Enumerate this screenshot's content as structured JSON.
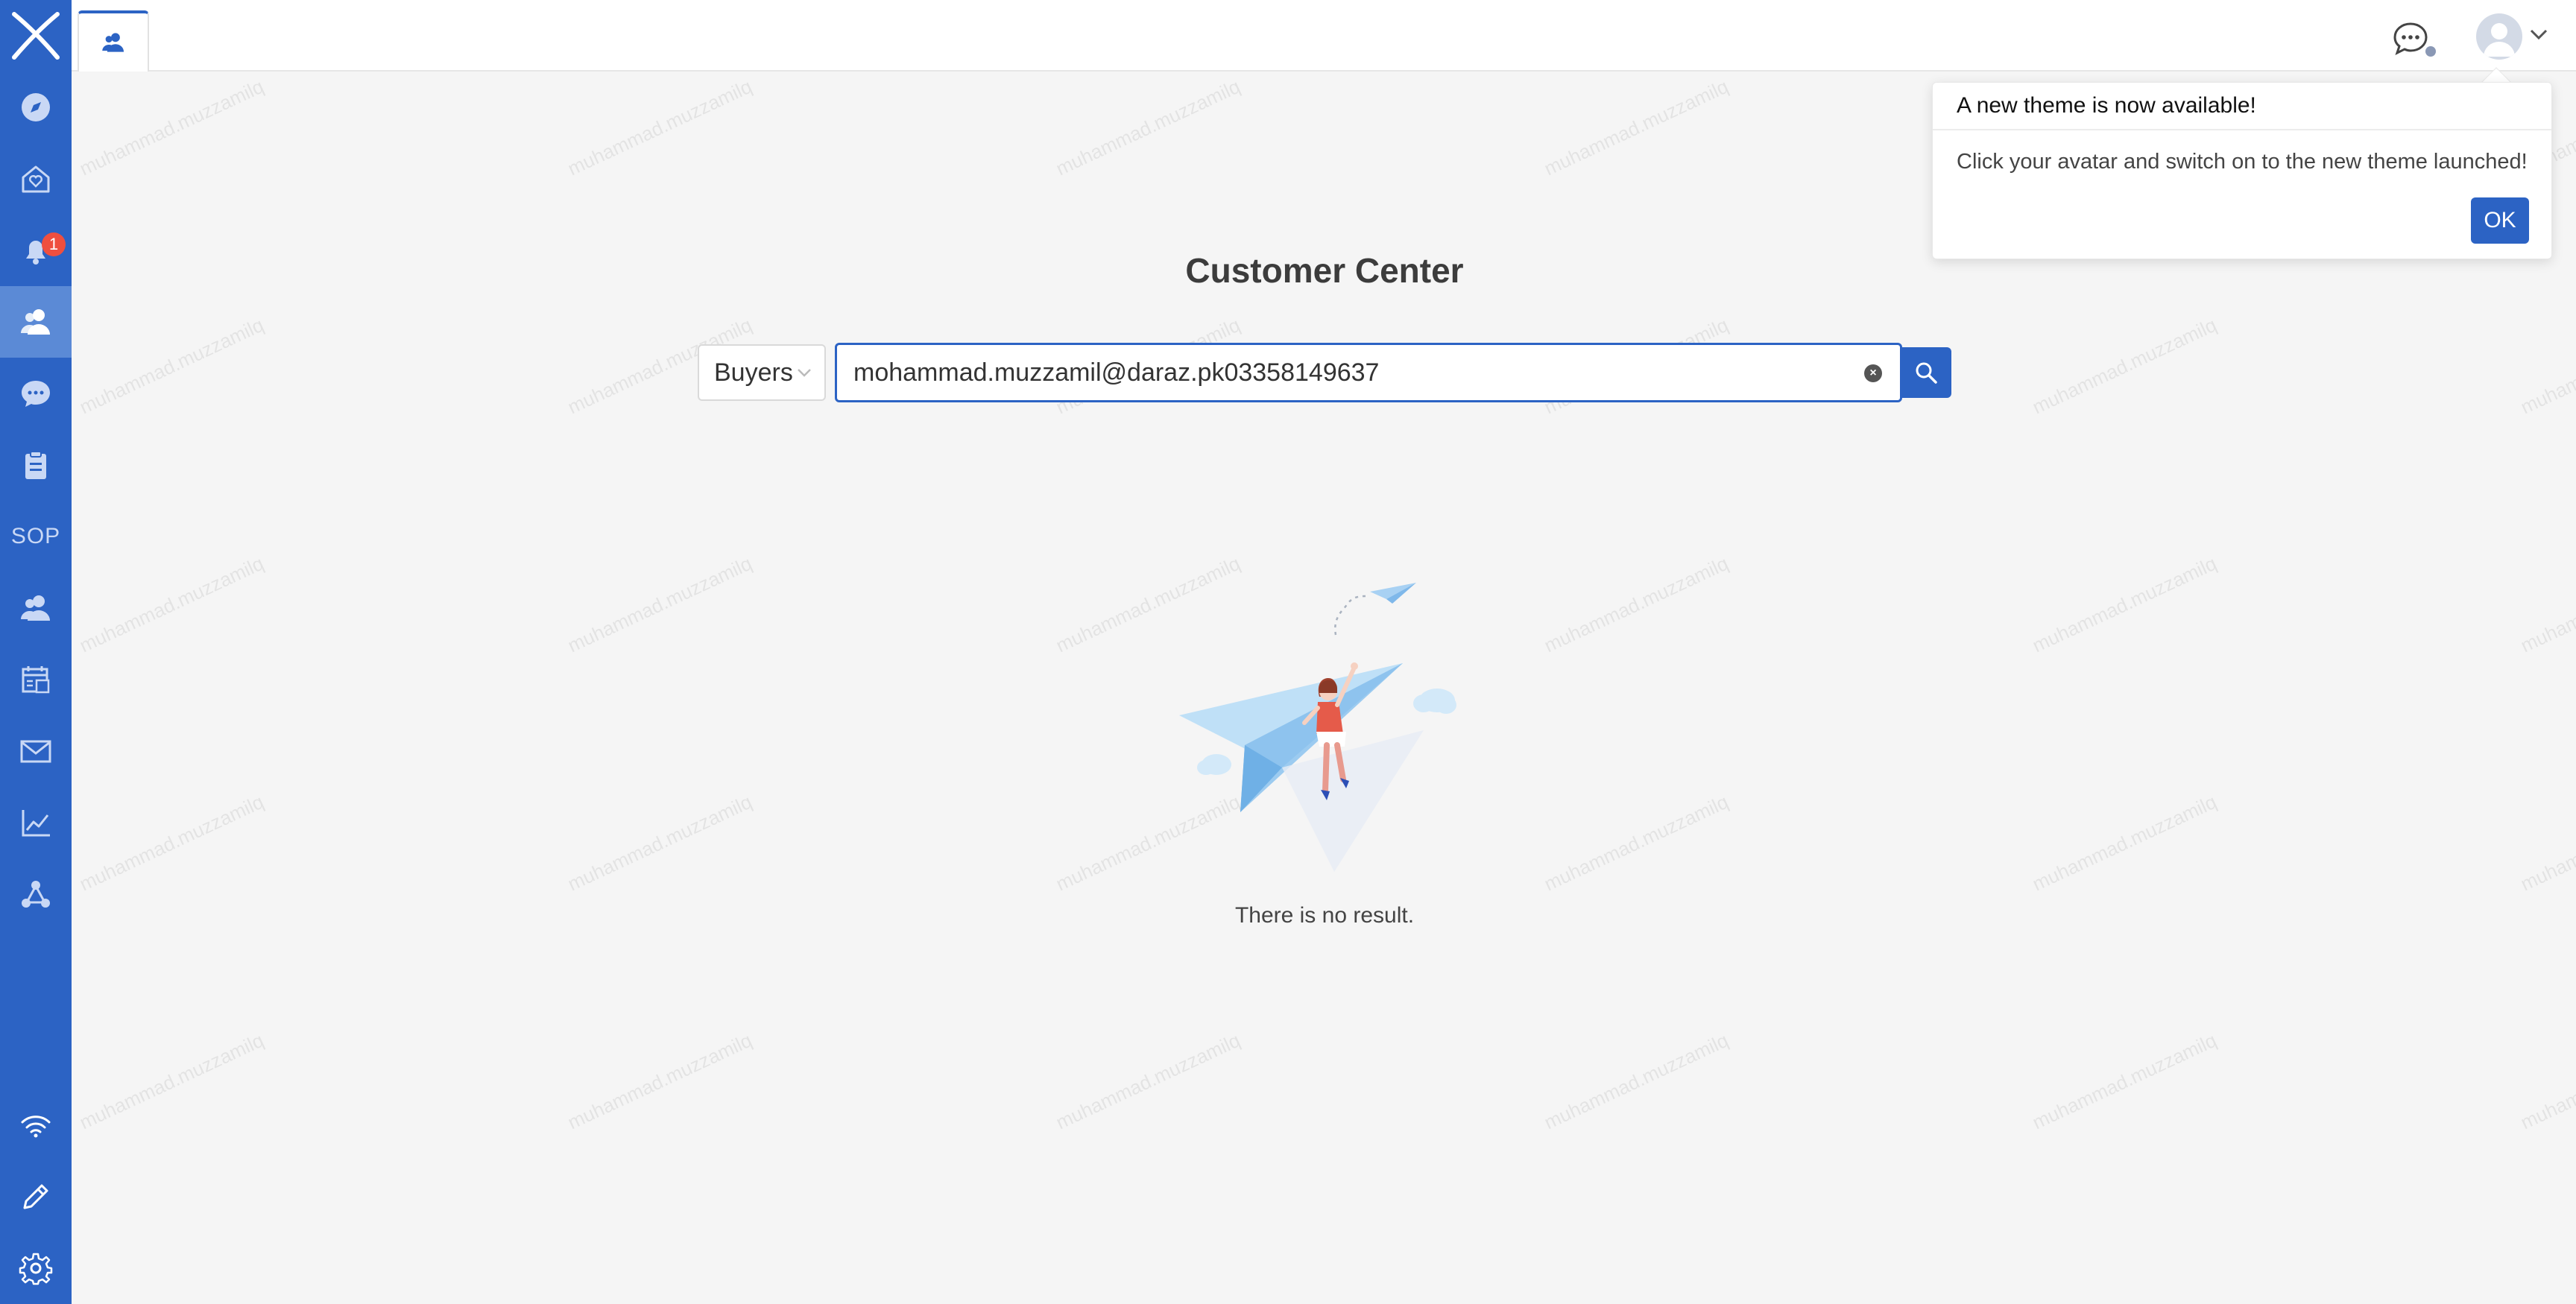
{
  "sidebar": {
    "logo_icon": "x-logo-icon",
    "items": [
      {
        "name": "compass",
        "icon": "compass-icon"
      },
      {
        "name": "home",
        "icon": "home-heart-icon"
      },
      {
        "name": "notifications",
        "icon": "bell-icon",
        "badge": "1"
      },
      {
        "name": "customers",
        "icon": "users-icon",
        "active": true
      },
      {
        "name": "chat",
        "icon": "chat-bubble-icon"
      },
      {
        "name": "tasks",
        "icon": "clipboard-icon"
      },
      {
        "name": "sop",
        "icon": "sop-icon",
        "label": "SOP"
      },
      {
        "name": "contacts",
        "icon": "users-icon"
      },
      {
        "name": "calendar",
        "icon": "calendar-icon"
      },
      {
        "name": "mail",
        "icon": "mail-icon"
      },
      {
        "name": "analytics",
        "icon": "line-chart-icon"
      },
      {
        "name": "network",
        "icon": "nodes-icon"
      }
    ],
    "bottom_items": [
      {
        "name": "wifi",
        "icon": "wifi-icon"
      },
      {
        "name": "edit",
        "icon": "pencil-icon"
      },
      {
        "name": "settings",
        "icon": "gear-icon"
      }
    ]
  },
  "topbar": {
    "active_tab_icon": "users-icon",
    "chat_icon": "chat-icon",
    "avatar_icon": "avatar-icon",
    "caret_icon": "chevron-down-icon"
  },
  "watermark": "muhammad.muzzamilq",
  "main": {
    "title": "Customer Center",
    "type_select": {
      "value": "Buyers"
    },
    "search": {
      "value": "mohammad.muzzamil@daraz.pk03358149637"
    },
    "empty_message": "There is no result."
  },
  "popover": {
    "title": "A new theme is now available!",
    "body": "Click your avatar and switch on to the new theme launched!",
    "ok_label": "OK"
  },
  "colors": {
    "brand": "#2c63c4",
    "sidebar_active": "#5b8ad6",
    "badge": "#ef4f3f",
    "background": "#f5f5f5"
  }
}
